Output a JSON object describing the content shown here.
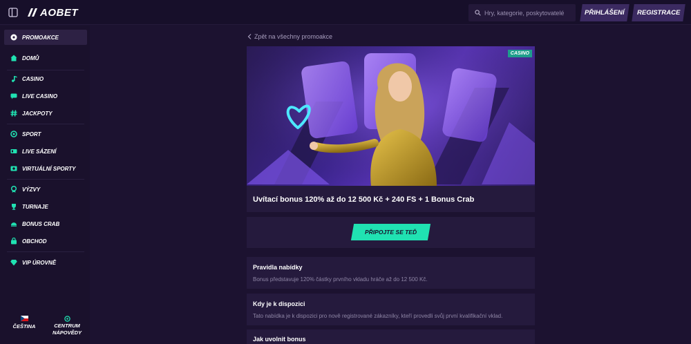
{
  "header": {
    "logo_text": "AOBET",
    "search_placeholder": "Hry, kategorie, poskytovatelé",
    "login_label": "PŘIHLÁŠENÍ",
    "register_label": "REGISTRACE"
  },
  "sidebar": {
    "items": [
      {
        "label": "PROMOAKCE",
        "icon": "gear-icon",
        "active": true
      },
      {
        "label": "DOMŮ",
        "icon": "home-icon"
      },
      {
        "label": "CASINO",
        "icon": "music-note-icon"
      },
      {
        "label": "LIVE CASINO",
        "icon": "chat-icon"
      },
      {
        "label": "JACKPOTY",
        "icon": "hash-icon"
      },
      {
        "label": "SPORT",
        "icon": "sport-icon"
      },
      {
        "label": "LIVE SÁZENÍ",
        "icon": "live-icon"
      },
      {
        "label": "VIRTUÁLNÍ SPORTY",
        "icon": "virtual-icon"
      },
      {
        "label": "VÝZVY",
        "icon": "badge-icon"
      },
      {
        "label": "TURNAJE",
        "icon": "trophy-icon"
      },
      {
        "label": "BONUS CRAB",
        "icon": "crab-icon"
      },
      {
        "label": "OBCHOD",
        "icon": "shop-icon"
      },
      {
        "label": "VIP ÚROVNĚ",
        "icon": "diamond-icon"
      }
    ],
    "language_label": "ČEŠTINA",
    "help_label_1": "CENTRUM",
    "help_label_2": "NÁPOVĚDY"
  },
  "main": {
    "back_link": "Zpět na všechny promoakce",
    "badge": "CASINO",
    "promo_title": "Uvítací bonus 120% až do 12 500 Kč + 240 FS + 1 Bonus Crab",
    "join_button": "PŘIPOJTE SE TEĎ",
    "sections": [
      {
        "title": "Pravidla nabídky",
        "text": "Bonus představuje 120% částky prvního vkladu hráče až do 12 500 Kč."
      },
      {
        "title": "Kdy je k dispozici",
        "text": "Tato nabídka je k dispozici pro nově registrované zákazníky, kteří provedli svůj první kvalifikační vklad."
      },
      {
        "title": "Jak uvolnit bonus",
        "text": ""
      }
    ]
  },
  "colors": {
    "accent": "#20e2b2",
    "background": "#1c1230",
    "panel": "#251a3d",
    "button": "#3b2a61"
  }
}
